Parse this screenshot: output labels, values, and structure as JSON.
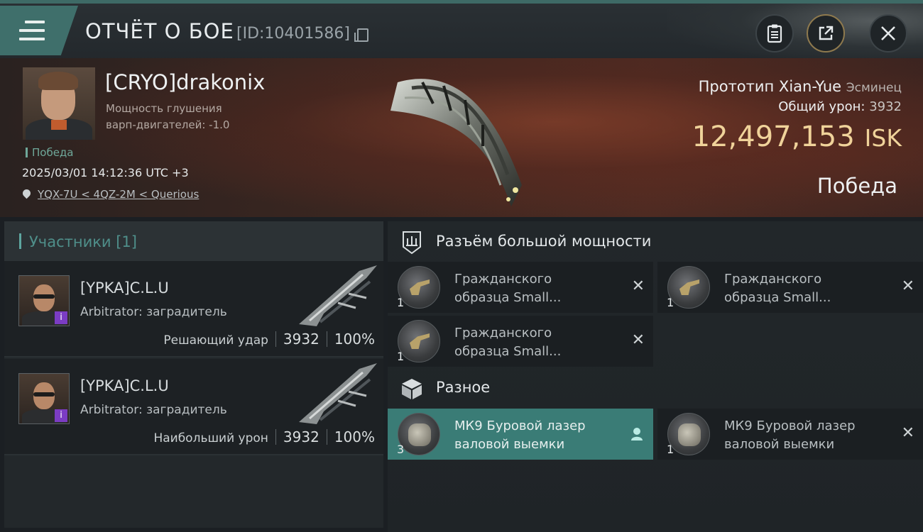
{
  "header": {
    "title": "ОТЧЁТ О БОЕ",
    "report_id": "[ID:10401586]"
  },
  "victim": {
    "name": "[CRYO]drakonix",
    "stat_line1": "Мощность глушения",
    "stat_line2": "варп-двигателей: -1.0",
    "result_tag": "Победа",
    "datetime": "2025/03/01 14:12:36 UTC +3",
    "location": "YQX-7U < 4QZ-2M < Querious",
    "ship_name": "Прототип Xian-Yue",
    "ship_class": "Эсминец",
    "damage_label": "Общий урон:",
    "damage_value": "3932",
    "isk_value": "12,497,153",
    "isk_unit": "ISK",
    "outcome": "Победа"
  },
  "participants": {
    "header": "Участники [1]",
    "items": [
      {
        "name": "[YPKA]C.L.U",
        "ship": "Arbitrator: заградитель",
        "role": "Решающий удар",
        "damage": "3932",
        "percent": "100%"
      },
      {
        "name": "[YPKA]C.L.U",
        "ship": "Arbitrator: заградитель",
        "role": "Наибольший урон",
        "damage": "3932",
        "percent": "100%"
      }
    ]
  },
  "fitting": {
    "high_slot_title": "Разъём большой мощности",
    "high_slots": [
      {
        "qty": "1",
        "name_line1": "Гражданского",
        "name_line2": "образца Small..."
      },
      {
        "qty": "1",
        "name_line1": "Гражданского",
        "name_line2": "образца Small..."
      },
      {
        "qty": "1",
        "name_line1": "Гражданского",
        "name_line2": "образца Small..."
      }
    ],
    "misc_title": "Разное",
    "misc": [
      {
        "qty": "3",
        "name_line1": "МК9 Буровой лазер",
        "name_line2": "валовой выемки"
      },
      {
        "qty": "1",
        "name_line1": "МК9 Буровой лазер",
        "name_line2": "валовой выемки"
      }
    ]
  },
  "colors": {
    "accent_teal": "#3f6f6b",
    "isk_gold": "#f0d39a",
    "highlight_row": "#3a7c76",
    "badge_purple": "#7b3cc3"
  },
  "icons": {
    "menu": "hamburger-icon",
    "copy": "copy-icon",
    "clipboard": "clipboard-icon",
    "share": "share-icon",
    "close": "close-icon",
    "location": "location-pin-icon",
    "high_slot": "high-slot-icon",
    "misc": "cube-icon",
    "remove": "x-icon",
    "owner": "person-icon"
  }
}
